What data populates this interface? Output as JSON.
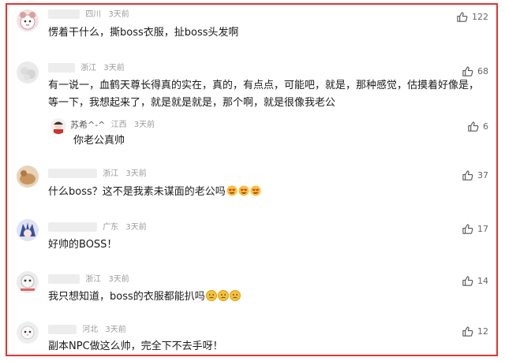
{
  "comments": [
    {
      "name": "",
      "region": "四川",
      "time": "3天前",
      "likes": "122",
      "text": "愣着干什么，撕boss衣服，扯boss头发啊",
      "emoji_count": 0
    },
    {
      "name": "",
      "region": "浙江",
      "time": "3天前",
      "likes": "68",
      "text_line1": "有一说一，血鹤天尊长得真的实在，真的，有点点，可能吧，就是，那种感觉，估摸着好像是，",
      "text_line2": "等一下，我想起来了，就是就是就是，那个啊，就是很像我老公",
      "reply": {
        "name": "苏希^-^",
        "region": "江西",
        "time": "3天前",
        "likes": "6",
        "text": "你老公真帅"
      }
    },
    {
      "name": "",
      "region": "浙江",
      "time": "3天前",
      "likes": "37",
      "text": "什么boss？这不是我素未谋面的老公吗",
      "emoji_icon": "heart-eyes-emoji",
      "emoji_count": 3
    },
    {
      "name": "",
      "region": "广东",
      "time": "3天前",
      "likes": "17",
      "text": "好帅的BOSS！",
      "emoji_count": 0
    },
    {
      "name": "",
      "region": "浙江",
      "time": "3天前",
      "likes": "14",
      "text": "我只想知道，boss的衣服都能扒吗",
      "emoji_icon": "worried-emoji",
      "emoji_count": 3
    },
    {
      "name": "",
      "region": "河北",
      "time": "3天前",
      "likes": "12",
      "text": "副本NPC做这么帅，完全下不去手呀！",
      "emoji_count": 0
    }
  ],
  "colors": {
    "border": "#e8312f",
    "meta": "#9a9a9a",
    "text": "#1a1a1a"
  }
}
